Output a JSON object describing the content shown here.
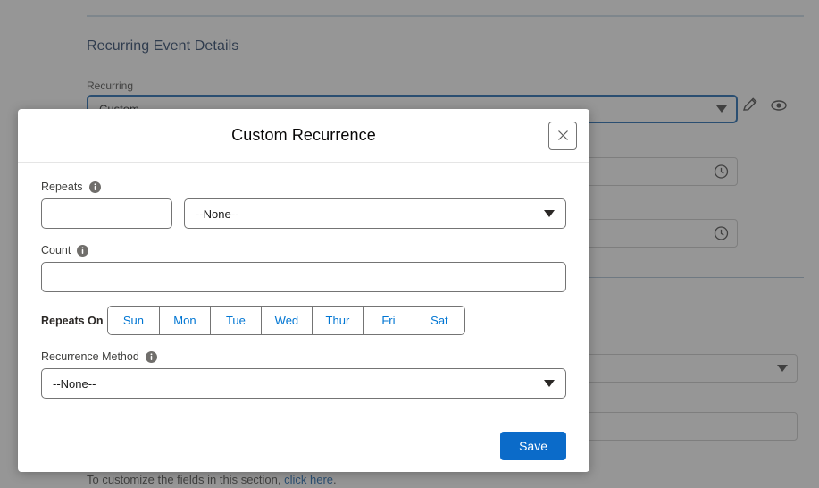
{
  "background": {
    "section_heading": "Recurring Event Details",
    "recurring_label": "Recurring",
    "recurring_value": "Custom",
    "footer_note_text": "To customize the fields in this section, ",
    "footer_note_link": "click here",
    "footer_note_suffix": ".",
    "edit_icon": "pencil-icon",
    "preview_icon": "eye-icon",
    "time_icon": "clock-icon"
  },
  "modal": {
    "title": "Custom Recurrence",
    "close_label": "×",
    "fields": {
      "repeats": {
        "label": "Repeats",
        "interval_value": "",
        "interval_placeholder": "",
        "unit_value": "--None--",
        "info_icon": "info-icon"
      },
      "count": {
        "label": "Count",
        "value": "",
        "placeholder": "",
        "info_icon": "info-icon"
      },
      "repeats_on": {
        "label": "Repeats On",
        "days": [
          "Sun",
          "Mon",
          "Tue",
          "Wed",
          "Thur",
          "Fri",
          "Sat"
        ]
      },
      "recurrence_method": {
        "label": "Recurrence Method",
        "value": "--None--",
        "info_icon": "info-icon"
      }
    },
    "footer": {
      "save_label": "Save"
    }
  },
  "colors": {
    "accent_blue": "#0176d3",
    "save_blue": "#0b6bc9",
    "link_blue": "#0b5cab",
    "heading_navy": "#16325c",
    "border_gray": "#747474"
  }
}
